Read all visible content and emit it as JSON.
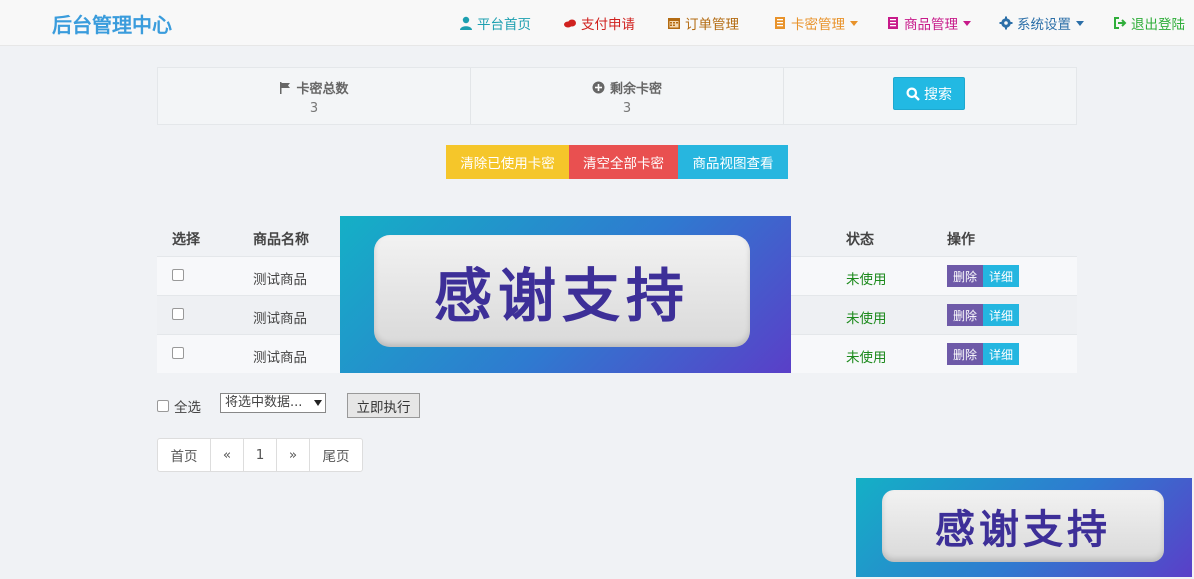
{
  "brand": "后台管理中心",
  "nav": {
    "home": "平台首页",
    "pay": "支付申请",
    "orders": "订单管理",
    "cards": "卡密管理",
    "goods": "商品管理",
    "settings": "系统设置",
    "logout": "退出登陆"
  },
  "colors": {
    "brand": "#3a9cdc",
    "home": "#1c9fb0",
    "pay": "#d0221f",
    "orders": "#b36b12",
    "cards": "#e8922a",
    "goods": "#c71a8a",
    "settings": "#2c6fa8",
    "logout": "#2fae3a"
  },
  "stats": {
    "total_label": "卡密总数",
    "total_value": "3",
    "remain_label": "剩余卡密",
    "remain_value": "3",
    "search_label": "搜索"
  },
  "actions": {
    "clear_used": "清除已使用卡密",
    "clear_all": "清空全部卡密",
    "view_goods": "商品视图查看"
  },
  "table": {
    "headers": {
      "select": "选择",
      "name": "商品名称",
      "status": "状态",
      "ops": "操作"
    },
    "rows": [
      {
        "name": "测试商品",
        "status": "未使用",
        "delete": "删除",
        "detail": "详细"
      },
      {
        "name": "测试商品",
        "status": "未使用",
        "delete": "删除",
        "detail": "详细"
      },
      {
        "name": "测试商品",
        "status": "未使用",
        "delete": "删除",
        "detail": "详细"
      }
    ]
  },
  "bulk": {
    "select_all": "全选",
    "selected_option": "将选中数据...",
    "execute": "立即执行"
  },
  "pagination": {
    "first": "首页",
    "prev": "«",
    "page": "1",
    "next": "»",
    "last": "尾页"
  },
  "banner_text": "感谢支持"
}
